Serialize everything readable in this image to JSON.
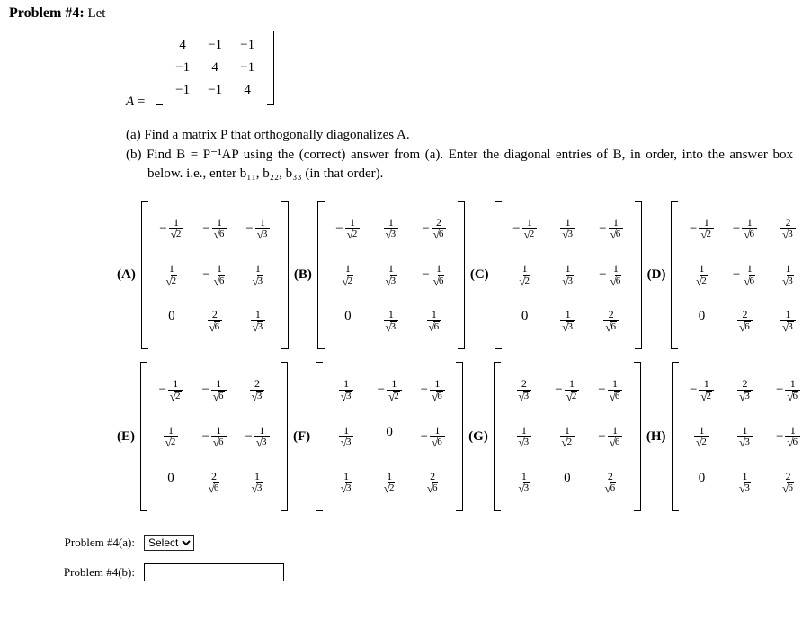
{
  "problem": {
    "heading_strong": "Problem #4:",
    "heading_rest": " Let",
    "Asym": "A",
    "eq": " = ",
    "Amatrix": [
      [
        "4",
        "−1",
        "−1"
      ],
      [
        "−1",
        "4",
        "−1"
      ],
      [
        "−1",
        "−1",
        "4"
      ]
    ],
    "part_a": "(a) Find a matrix P that orthogonally diagonalizes A.",
    "part_b": "(b) Find B = P⁻¹AP using the (correct) answer from (a). Enter the diagonal entries of B, in order, into the answer box below. i.e., enter b₁₁, b₂₂, b₃₃ (in that order)."
  },
  "root_symbol": "√",
  "choice_labels": [
    "(A)",
    "(B)",
    "(C)",
    "(D)",
    "(E)",
    "(F)",
    "(G)",
    "(H)"
  ],
  "choices": [
    [
      [
        {
          "n": "1",
          "d": "2",
          "neg": true
        },
        {
          "n": "1",
          "d": "6",
          "neg": true
        },
        {
          "n": "1",
          "d": "3",
          "neg": true
        }
      ],
      [
        {
          "n": "1",
          "d": "2",
          "neg": false
        },
        {
          "n": "1",
          "d": "6",
          "neg": true
        },
        {
          "n": "1",
          "d": "3",
          "neg": false
        }
      ],
      [
        {
          "zero": true
        },
        {
          "n": "2",
          "d": "6",
          "neg": false
        },
        {
          "n": "1",
          "d": "3",
          "neg": false
        }
      ]
    ],
    [
      [
        {
          "n": "1",
          "d": "2",
          "neg": true
        },
        {
          "n": "1",
          "d": "3",
          "neg": false
        },
        {
          "n": "2",
          "d": "6",
          "neg": true
        }
      ],
      [
        {
          "n": "1",
          "d": "2",
          "neg": false
        },
        {
          "n": "1",
          "d": "3",
          "neg": false
        },
        {
          "n": "1",
          "d": "6",
          "neg": true
        }
      ],
      [
        {
          "zero": true
        },
        {
          "n": "1",
          "d": "3",
          "neg": false
        },
        {
          "n": "1",
          "d": "6",
          "neg": false
        }
      ]
    ],
    [
      [
        {
          "n": "1",
          "d": "2",
          "neg": true
        },
        {
          "n": "1",
          "d": "3",
          "neg": false
        },
        {
          "n": "1",
          "d": "6",
          "neg": true
        }
      ],
      [
        {
          "n": "1",
          "d": "2",
          "neg": false
        },
        {
          "n": "1",
          "d": "3",
          "neg": false
        },
        {
          "n": "1",
          "d": "6",
          "neg": true
        }
      ],
      [
        {
          "zero": true
        },
        {
          "n": "1",
          "d": "3",
          "neg": false
        },
        {
          "n": "2",
          "d": "6",
          "neg": false
        }
      ]
    ],
    [
      [
        {
          "n": "1",
          "d": "2",
          "neg": true
        },
        {
          "n": "1",
          "d": "6",
          "neg": true
        },
        {
          "n": "2",
          "d": "3",
          "neg": false
        }
      ],
      [
        {
          "n": "1",
          "d": "2",
          "neg": false
        },
        {
          "n": "1",
          "d": "6",
          "neg": true
        },
        {
          "n": "1",
          "d": "3",
          "neg": false
        }
      ],
      [
        {
          "zero": true
        },
        {
          "n": "2",
          "d": "6",
          "neg": false
        },
        {
          "n": "1",
          "d": "3",
          "neg": false
        }
      ]
    ],
    [
      [
        {
          "n": "1",
          "d": "2",
          "neg": true
        },
        {
          "n": "1",
          "d": "6",
          "neg": true
        },
        {
          "n": "2",
          "d": "3",
          "neg": false
        }
      ],
      [
        {
          "n": "1",
          "d": "2",
          "neg": false
        },
        {
          "n": "1",
          "d": "6",
          "neg": true
        },
        {
          "n": "1",
          "d": "3",
          "neg": true
        }
      ],
      [
        {
          "zero": true
        },
        {
          "n": "2",
          "d": "6",
          "neg": false
        },
        {
          "n": "1",
          "d": "3",
          "neg": false
        }
      ]
    ],
    [
      [
        {
          "n": "1",
          "d": "3",
          "neg": false
        },
        {
          "n": "1",
          "d": "2",
          "neg": true
        },
        {
          "n": "1",
          "d": "6",
          "neg": true
        }
      ],
      [
        {
          "n": "1",
          "d": "3",
          "neg": false
        },
        {
          "zero": true
        },
        {
          "n": "1",
          "d": "6",
          "neg": true
        }
      ],
      [
        {
          "n": "1",
          "d": "3",
          "neg": false
        },
        {
          "n": "1",
          "d": "2",
          "neg": false
        },
        {
          "n": "2",
          "d": "6",
          "neg": false
        }
      ]
    ],
    [
      [
        {
          "n": "2",
          "d": "3",
          "neg": false
        },
        {
          "n": "1",
          "d": "2",
          "neg": true
        },
        {
          "n": "1",
          "d": "6",
          "neg": true
        }
      ],
      [
        {
          "n": "1",
          "d": "3",
          "neg": false
        },
        {
          "n": "1",
          "d": "2",
          "neg": false
        },
        {
          "n": "1",
          "d": "6",
          "neg": true
        }
      ],
      [
        {
          "n": "1",
          "d": "3",
          "neg": false
        },
        {
          "zero": true
        },
        {
          "n": "2",
          "d": "6",
          "neg": false
        }
      ]
    ],
    [
      [
        {
          "n": "1",
          "d": "2",
          "neg": true
        },
        {
          "n": "2",
          "d": "3",
          "neg": false
        },
        {
          "n": "1",
          "d": "6",
          "neg": true
        }
      ],
      [
        {
          "n": "1",
          "d": "2",
          "neg": false
        },
        {
          "n": "1",
          "d": "3",
          "neg": false
        },
        {
          "n": "1",
          "d": "6",
          "neg": true
        }
      ],
      [
        {
          "zero": true
        },
        {
          "n": "1",
          "d": "3",
          "neg": false
        },
        {
          "n": "2",
          "d": "6",
          "neg": false
        }
      ]
    ]
  ],
  "answers": {
    "label_a": "Problem #4(a):",
    "label_b": "Problem #4(b):",
    "select_placeholder": "Select",
    "textbox_value": ""
  }
}
